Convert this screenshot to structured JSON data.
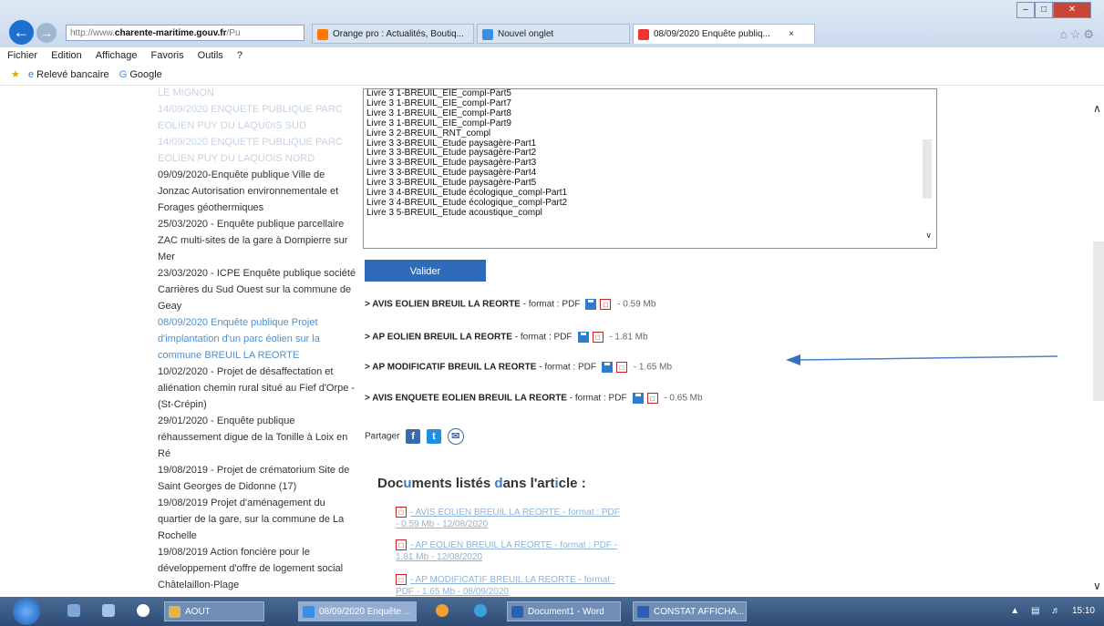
{
  "browser": {
    "address_prefix": "http://www.",
    "address_domain": "charente-maritime.gouv.fr",
    "address_suffix": "/Pu",
    "tabs": [
      {
        "label": "Orange pro : Actualités, Boutiq..."
      },
      {
        "label": "Nouvel onglet"
      },
      {
        "label": "08/09/2020 Enquête publiq...",
        "close": "×"
      }
    ],
    "menu": [
      "Fichier",
      "Edition",
      "Affichage",
      "Favoris",
      "Outils",
      "?"
    ],
    "favorites": [
      "Relevé bancaire",
      "Google"
    ]
  },
  "left_list": [
    {
      "text": "LE MIGNON",
      "style": "faded"
    },
    {
      "text": "14/09/2020 ENQUETE PUBLIQUE PARC EOLIEN PUY DU LAQUOIS SUD",
      "style": "faded"
    },
    {
      "text": "14/09/2020 ENQUETE PUBLIQUE PARC EOLIEN PUY DU LAQUOIS NORD",
      "style": "faded"
    },
    {
      "text": "09/09/2020-Enquête publique Ville de Jonzac Autorisation environnementale et Forages géothermiques",
      "style": "normal"
    },
    {
      "text": "25/03/2020 - Enquête publique parcellaire ZAC multi-sites de la gare à Dompierre sur Mer",
      "style": "normal"
    },
    {
      "text": "23/03/2020 - ICPE Enquête publique société Carrières du Sud Ouest sur la commune de Geay",
      "style": "normal"
    },
    {
      "text": "08/09/2020 Enquête publique Projet d'implantation d'un parc éolien sur la commune BREUIL LA REORTE",
      "style": "active"
    },
    {
      "text": "10/02/2020 - Projet de désaffectation et aliénation chemin rural situé au Fief d'Orpe - (St-Crépin)",
      "style": "normal"
    },
    {
      "text": "29/01/2020 - Enquête publique réhaussement digue de la Tonille à Loix en Ré",
      "style": "normal"
    },
    {
      "text": "19/08/2019 - Projet de crématorium Site de Saint Georges de Didonne (17)",
      "style": "normal"
    },
    {
      "text": "19/08/2019 Projet d'aménagement du quartier de la gare, sur la commune de La Rochelle",
      "style": "normal"
    },
    {
      "text": "19/08/2019 Action foncière pour le développement d'offre de logement social Châtelaillon-Plage",
      "style": "normal"
    }
  ],
  "listbox": {
    "options": [
      "Livre 3 1-BREUIL_EIE_compl-Part5",
      "Livre 3 1-BREUIL_EIE_compl-Part7",
      "Livre 3 1-BREUIL_EIE_compl-Part8",
      "Livre 3 1-BREUIL_EIE_compl-Part9",
      "Livre 3 2-BREUIL_RNT_compl",
      "Livre 3 3-BREUIL_Etude paysagère-Part1",
      "Livre 3 3-BREUIL_Etude paysagère-Part2",
      "Livre 3 3-BREUIL_Etude paysagère-Part3",
      "Livre 3 3-BREUIL_Etude paysagère-Part4",
      "Livre 3 3-BREUIL_Etude paysagère-Part5",
      "Livre 3 4-BREUIL_Etude écologique_compl-Part1",
      "Livre 3 4-BREUIL_Etude écologique_compl-Part2",
      "Livre 3 5-BREUIL_Etude acoustique_compl"
    ]
  },
  "validate_label": "Valider",
  "documents": [
    {
      "title": "> AVIS EOLIEN BREUIL LA REORTE",
      "format": " - format : PDF",
      "size": " - 0.59 Mb"
    },
    {
      "title": "> AP EOLIEN BREUIL LA REORTE",
      "format": " - format : PDF",
      "size": " - 1.81 Mb"
    },
    {
      "title": "> AP MODIFICATIF BREUIL LA REORTE",
      "format": " - format : PDF",
      "size": " - 1.65 Mb"
    },
    {
      "title": "> AVIS ENQUETE EOLIEN BREUIL LA REORTE",
      "format": " - format : PDF",
      "size": " - 0.65 Mb"
    }
  ],
  "share_label": "Partager",
  "docs_listed": {
    "title_parts": [
      "Doc",
      "u",
      "ments listés ",
      "d",
      "ans l'art",
      "i",
      "cle :"
    ],
    "items": [
      "- AVIS EOLIEN BREUIL LA REORTE - format : PDF - 0.59 Mb - 12/08/2020",
      "- AP EOLIEN BREUIL LA REORTE - format : PDF - 1.81 Mb - 12/08/2020",
      "- AP MODIFICATIF BREUIL LA REORTE - format : PDF - 1.65 Mb - 08/09/2020"
    ]
  },
  "taskbar": {
    "items": [
      {
        "label": "AOUT"
      },
      {
        "label": "08/09/2020 Enquête ..."
      },
      {
        "label": "Document1 - Word"
      },
      {
        "label": "CONSTAT AFFICHA..."
      }
    ],
    "clock": "15:10"
  }
}
